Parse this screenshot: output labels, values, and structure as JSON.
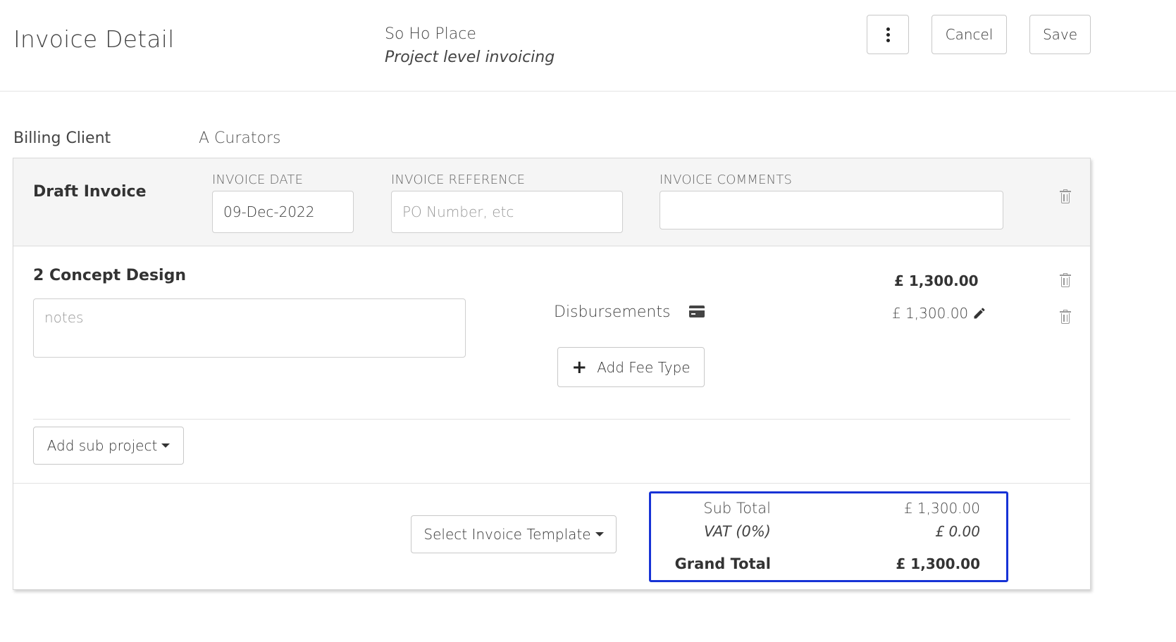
{
  "header": {
    "title": "Invoice Detail",
    "project_name": "So Ho Place",
    "project_subtitle": "Project level invoicing",
    "more_icon": "more-vertical-icon",
    "cancel_label": "Cancel",
    "save_label": "Save"
  },
  "billing": {
    "label": "Billing Client",
    "value": "A Curators"
  },
  "invoice": {
    "title": "Draft Invoice",
    "date_label": "INVOICE DATE",
    "date_value": "09-Dec-2022",
    "reference_label": "INVOICE REFERENCE",
    "reference_placeholder": "PO Number, etc",
    "comments_label": "INVOICE COMMENTS",
    "comments_value": ""
  },
  "sub_project": {
    "title": "2 Concept Design",
    "amount": "£ 1,300.00",
    "notes_placeholder": "notes",
    "fee_label": "Disbursements",
    "fee_icon": "credit-card-icon",
    "fee_amount": "£ 1,300.00",
    "add_fee_label": "Add Fee Type"
  },
  "actions": {
    "add_sub_project_label": "Add sub project",
    "select_template_label": "Select Invoice Template"
  },
  "totals": {
    "sub_total_label": "Sub Total",
    "sub_total_value": "£ 1,300.00",
    "vat_label": "VAT (0%)",
    "vat_value": "£ 0.00",
    "grand_total_label": "Grand Total",
    "grand_total_value": "£ 1,300.00",
    "highlight_color": "#1733d6"
  }
}
